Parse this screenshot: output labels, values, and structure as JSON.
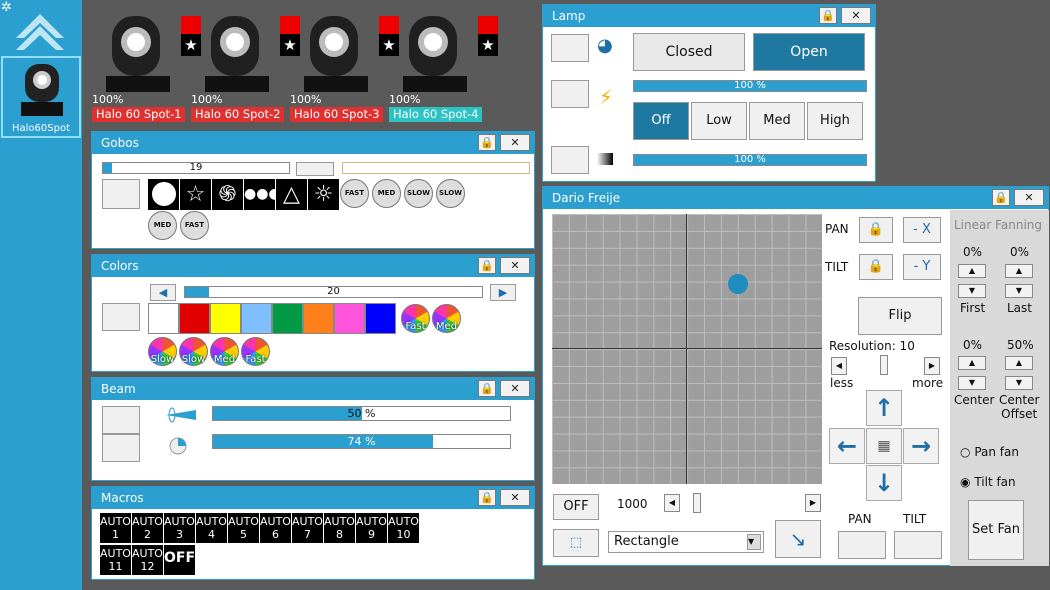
{
  "sidebar": {
    "fixture_label": "Halo60Spot"
  },
  "fixtures": [
    {
      "name": "Halo 60 Spot-1",
      "dimmer": "100%",
      "color": "#e03030"
    },
    {
      "name": "Halo 60 Spot-2",
      "dimmer": "100%",
      "color": "#e03030"
    },
    {
      "name": "Halo 60 Spot-3",
      "dimmer": "100%",
      "color": "#e03030"
    },
    {
      "name": "Halo 60 Spot-4",
      "dimmer": "100%",
      "color": "#2bc3c3"
    }
  ],
  "gobos": {
    "title": "Gobos",
    "value": "19",
    "value_fraction": 0.05,
    "rotate_labels": [
      "FAST",
      "MED",
      "SLOW",
      "SLOW",
      "MED",
      "FAST"
    ]
  },
  "colors": {
    "title": "Colors",
    "value": "20",
    "value_fraction": 0.08,
    "swatches": [
      "#ffffff",
      "#e00000",
      "#ffff00",
      "#7fbfff",
      "#009a44",
      "#ff7f1a",
      "#ff55dd",
      "#0000ff"
    ],
    "wheel_labels": [
      "Fast",
      "Med",
      "Slow",
      "Slow",
      "Med",
      "Fast"
    ]
  },
  "beam": {
    "title": "Beam",
    "zoom": "50 %",
    "zoom_fraction": 0.5,
    "focus": "74 %",
    "focus_fraction": 0.74
  },
  "macros": {
    "title": "Macros",
    "items": [
      "AUTO\n1",
      "AUTO\n2",
      "AUTO\n3",
      "AUTO\n4",
      "AUTO\n5",
      "AUTO\n6",
      "AUTO\n7",
      "AUTO\n8",
      "AUTO\n9",
      "AUTO\n10",
      "AUTO\n11",
      "AUTO\n12",
      "OFF"
    ]
  },
  "lamp": {
    "title": "Lamp",
    "closed": "Closed",
    "open": "Open",
    "intensity": "100 %",
    "intensity_fraction": 1.0,
    "speeds": [
      "Off",
      "Low",
      "Med",
      "High"
    ],
    "dimmer": "100 %",
    "dimmer_fraction": 1.0
  },
  "pantilt": {
    "title": "Dario Freije",
    "pan": "PAN",
    "tilt": "TILT",
    "minus_x": "- X",
    "minus_y": "- Y",
    "flip": "Flip",
    "resolution": "Resolution: 10",
    "less": "less",
    "more": "more",
    "off": "OFF",
    "speed": "1000",
    "shape": "Rectangle",
    "pan_bottom": "PAN",
    "tilt_bottom": "TILT",
    "dot_x": 0.69,
    "dot_y": 0.26
  },
  "fanning": {
    "title": "Linear Fanning",
    "first_pct": "0%",
    "last_pct": "0%",
    "first": "First",
    "last": "Last",
    "center_pct": "0%",
    "offset_pct": "50%",
    "center": "Center",
    "center_offset": "Center\nOffset",
    "pan_fan": "Pan fan",
    "tilt_fan": "Tilt fan",
    "set_fan": "Set Fan"
  }
}
